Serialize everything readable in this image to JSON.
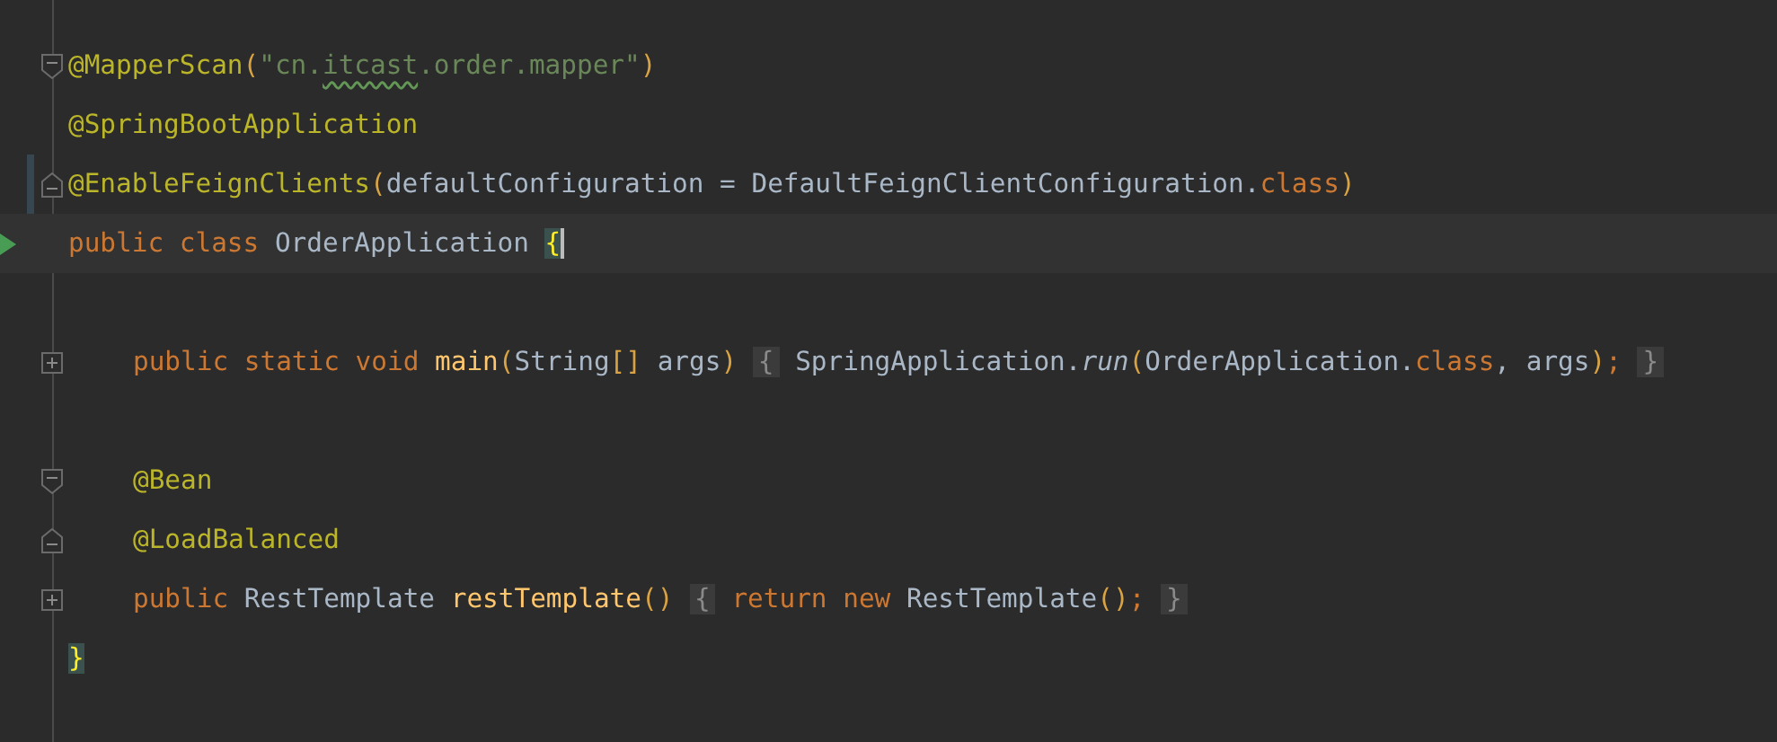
{
  "editor": {
    "lines": [
      {
        "kind": "code",
        "gutter": {
          "kind": "fold-start"
        },
        "tokens": [
          {
            "text": "@MapperScan",
            "kind": "annotation"
          },
          {
            "text": "(",
            "kind": "paren"
          },
          {
            "text": "\"cn.",
            "kind": "string"
          },
          {
            "text": "itcast",
            "kind": "typo"
          },
          {
            "text": ".order.mapper\"",
            "kind": "string"
          },
          {
            "text": ")",
            "kind": "paren"
          }
        ]
      },
      {
        "kind": "code",
        "tokens": [
          {
            "text": "@SpringBootApplication",
            "kind": "annotation"
          }
        ]
      },
      {
        "kind": "code",
        "gutter": {
          "kind": "fold-end"
        },
        "changed": true,
        "tokens": [
          {
            "text": "@EnableFeignClients",
            "kind": "annotation"
          },
          {
            "text": "(",
            "kind": "paren"
          },
          {
            "text": "defaultConfiguration = DefaultFeignClientConfiguration.",
            "kind": "plain"
          },
          {
            "text": "class",
            "kind": "keyword"
          },
          {
            "text": ")",
            "kind": "paren"
          }
        ]
      },
      {
        "kind": "code",
        "gutter": {
          "kind": "run"
        },
        "current": true,
        "tokens": [
          {
            "text": "public class ",
            "kind": "keyword"
          },
          {
            "text": "OrderApplication ",
            "kind": "plain"
          },
          {
            "text": "{",
            "kind": "match"
          }
        ],
        "children": [
          {
            "kind": "blank"
          },
          {
            "kind": "code",
            "gutter": {
              "kind": "fold-collapsed"
            },
            "tokens": [
              {
                "text": "public static void ",
                "kind": "keyword"
              },
              {
                "text": "main",
                "kind": "method"
              },
              {
                "text": "(",
                "kind": "paren"
              },
              {
                "text": "String",
                "kind": "plain"
              },
              {
                "text": "[]",
                "kind": "paren"
              },
              {
                "text": " args",
                "kind": "plain"
              },
              {
                "text": ") ",
                "kind": "paren"
              },
              {
                "text": "{",
                "kind": "folded"
              },
              {
                "text": " SpringApplication.",
                "kind": "plain"
              },
              {
                "text": "run",
                "kind": "italic"
              },
              {
                "text": "(",
                "kind": "paren"
              },
              {
                "text": "OrderApplication.",
                "kind": "plain"
              },
              {
                "text": "class",
                "kind": "keyword"
              },
              {
                "text": ", args",
                "kind": "plain"
              },
              {
                "text": ")",
                "kind": "paren"
              },
              {
                "text": "; ",
                "kind": "keyword"
              },
              {
                "text": "}",
                "kind": "folded"
              }
            ]
          },
          {
            "kind": "blank"
          },
          {
            "kind": "code",
            "gutter": {
              "kind": "fold-start"
            },
            "tokens": [
              {
                "text": "@Bean",
                "kind": "annotation"
              }
            ]
          },
          {
            "kind": "code",
            "gutter": {
              "kind": "fold-end"
            },
            "tokens": [
              {
                "text": "@LoadBalanced",
                "kind": "annotation"
              }
            ]
          },
          {
            "kind": "code",
            "gutter": {
              "kind": "fold-collapsed"
            },
            "tokens": [
              {
                "text": "public ",
                "kind": "keyword"
              },
              {
                "text": "RestTemplate ",
                "kind": "plain"
              },
              {
                "text": "restTemplate",
                "kind": "method"
              },
              {
                "text": "() ",
                "kind": "paren"
              },
              {
                "text": "{",
                "kind": "folded"
              },
              {
                "text": " return new ",
                "kind": "keyword"
              },
              {
                "text": "RestTemplate",
                "kind": "plain"
              },
              {
                "text": "()",
                "kind": "paren"
              },
              {
                "text": "; ",
                "kind": "keyword"
              },
              {
                "text": "}",
                "kind": "folded"
              }
            ]
          }
        ]
      },
      {
        "kind": "code",
        "tokens": [
          {
            "text": "}",
            "kind": "match"
          }
        ]
      }
    ]
  }
}
